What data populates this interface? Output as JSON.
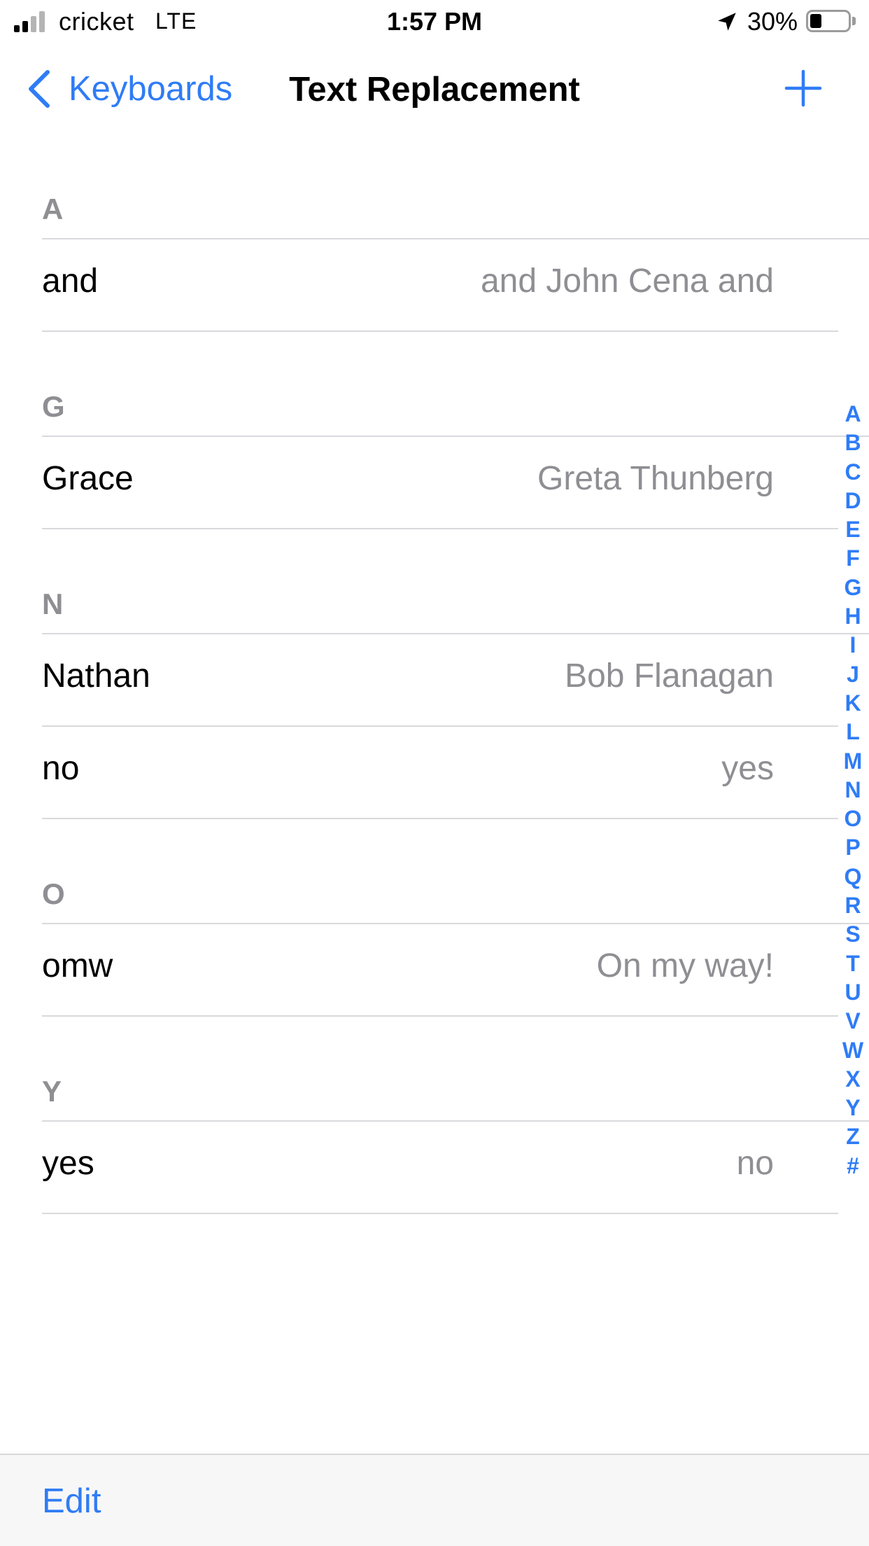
{
  "status_bar": {
    "carrier": "cricket",
    "network": "LTE",
    "time": "1:57 PM",
    "battery_percent": "30%",
    "battery_level": 0.3,
    "signal_bars_active": 2,
    "signal_bars_total": 4,
    "icons": [
      "signal-icon",
      "location-arrow-icon",
      "battery-icon"
    ]
  },
  "nav": {
    "back_label": "Keyboards",
    "title": "Text Replacement",
    "icons": [
      "chevron-left-icon",
      "plus-icon"
    ]
  },
  "sections": [
    {
      "letter": "A",
      "rows": [
        {
          "phrase": "and",
          "shortcut": "and John Cena and"
        }
      ]
    },
    {
      "letter": "G",
      "rows": [
        {
          "phrase": "Grace",
          "shortcut": "Greta Thunberg"
        }
      ]
    },
    {
      "letter": "N",
      "rows": [
        {
          "phrase": "Nathan",
          "shortcut": "Bob Flanagan"
        },
        {
          "phrase": "no",
          "shortcut": "yes"
        }
      ]
    },
    {
      "letter": "O",
      "rows": [
        {
          "phrase": "omw",
          "shortcut": "On my way!"
        }
      ]
    },
    {
      "letter": "Y",
      "rows": [
        {
          "phrase": "yes",
          "shortcut": "no"
        }
      ]
    }
  ],
  "index_letters": [
    "A",
    "B",
    "C",
    "D",
    "E",
    "F",
    "G",
    "H",
    "I",
    "J",
    "K",
    "L",
    "M",
    "N",
    "O",
    "P",
    "Q",
    "R",
    "S",
    "T",
    "U",
    "V",
    "W",
    "X",
    "Y",
    "Z",
    "#"
  ],
  "toolbar": {
    "edit_label": "Edit"
  },
  "colors": {
    "accent": "#2f7cf6",
    "secondary_text": "#8e8e93",
    "separator": "#d9d9dd",
    "toolbar_background": "#f7f7f7"
  }
}
